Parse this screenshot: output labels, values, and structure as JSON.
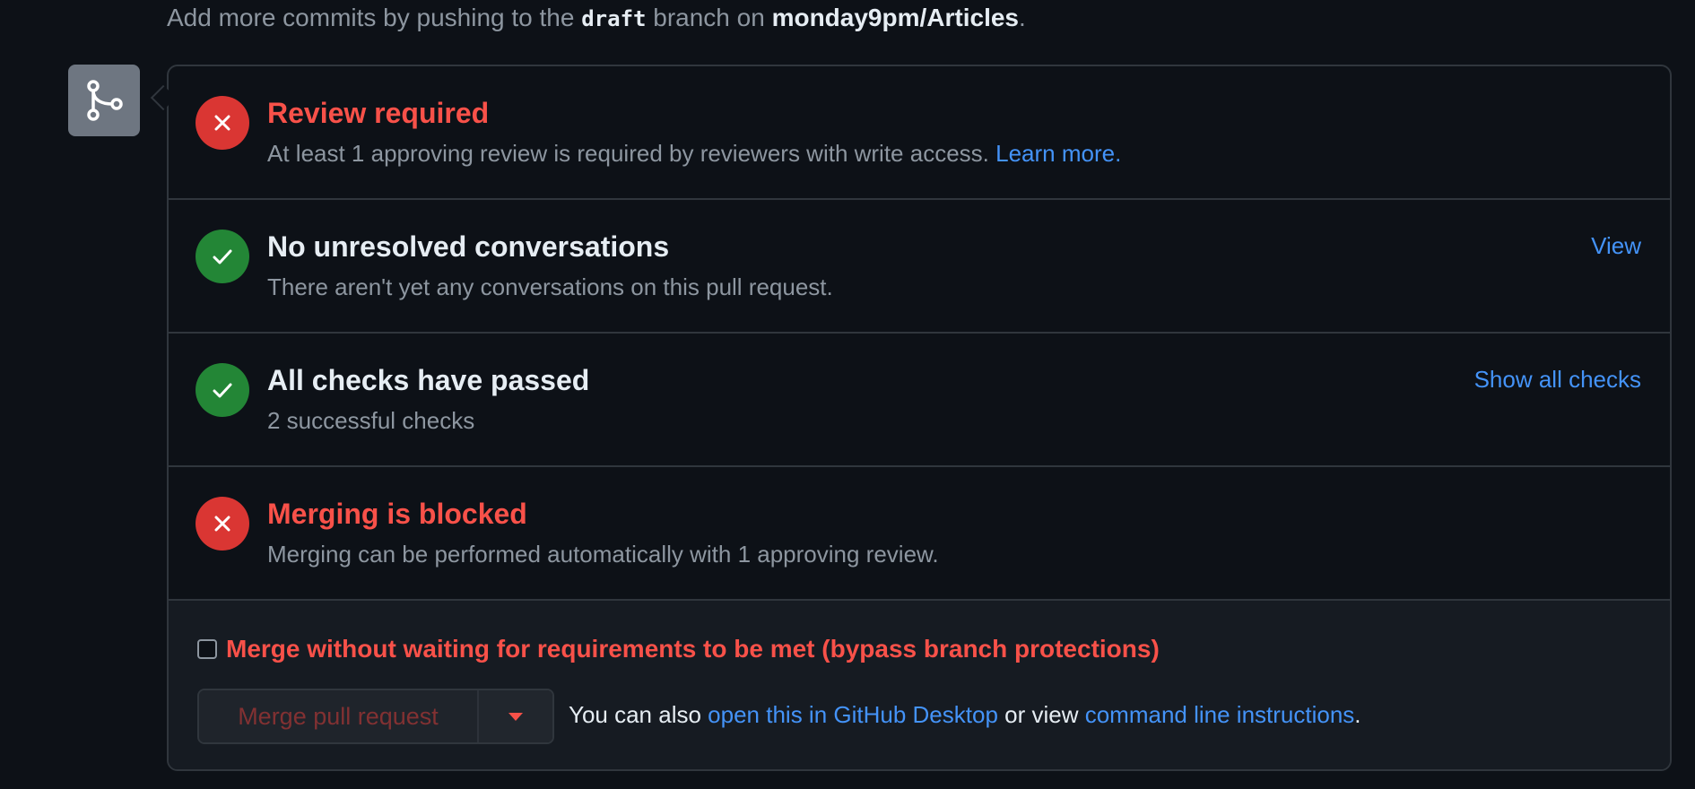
{
  "top_note": {
    "prefix": "Add more commits by pushing to the ",
    "branch": "draft",
    "middle": " branch on ",
    "repo": "monday9pm/Articles",
    "suffix": "."
  },
  "merge_icon": "git-merge-icon",
  "rows": [
    {
      "status": "fail",
      "icon": "x-icon",
      "title": "Review required",
      "desc": "At least 1 approving review is required by reviewers with write access. ",
      "desc_link": "Learn more."
    },
    {
      "status": "pass",
      "icon": "check-icon",
      "title": "No unresolved conversations",
      "desc": "There aren't yet any conversations on this pull request.",
      "action": "View"
    },
    {
      "status": "pass",
      "icon": "check-icon",
      "title": "All checks have passed",
      "desc": "2 successful checks",
      "action": "Show all checks"
    },
    {
      "status": "fail",
      "icon": "x-icon",
      "title": "Merging is blocked",
      "desc": "Merging can be performed automatically with 1 approving review."
    }
  ],
  "bypass": {
    "checked": false,
    "label": "Merge without waiting for requirements to be met (bypass branch protections)"
  },
  "merge_button": {
    "label": "Merge pull request",
    "disabled": true
  },
  "also": {
    "prefix": "You can also ",
    "desktop_link": "open this in GitHub Desktop",
    "middle": " or view ",
    "cli_link": "command line instructions",
    "suffix": "."
  },
  "colors": {
    "background": "#0d1117",
    "border": "#30363d",
    "fail": "#da3633",
    "pass": "#238636",
    "fail_text": "#f85149",
    "link": "#4493f8",
    "muted": "#8d96a0"
  }
}
